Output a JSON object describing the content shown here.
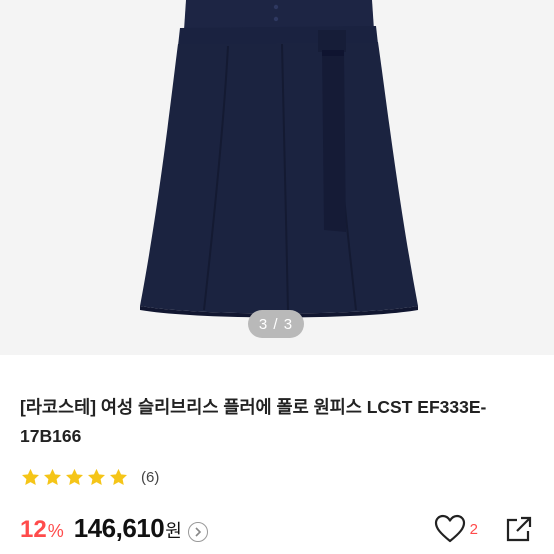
{
  "gallery": {
    "counter": "3 / 3",
    "image_alt": "navy polo dress with belt"
  },
  "product": {
    "title": "[라코스테] 여성 슬리브리스 플러에 폴로 원피스 LCST EF333E-17B166",
    "rating_stars": 5,
    "review_count": "(6)",
    "discount_number": "12",
    "discount_symbol": "%",
    "price": "146,610",
    "currency": "원",
    "like_count": "2"
  },
  "colors": {
    "discount": "#ff4b4b",
    "star": "#f5c518",
    "dress": "#1b2340"
  },
  "icons": {
    "star": "star-icon",
    "price_info": "chevron-right-icon",
    "like": "heart-icon",
    "share": "share-icon"
  }
}
